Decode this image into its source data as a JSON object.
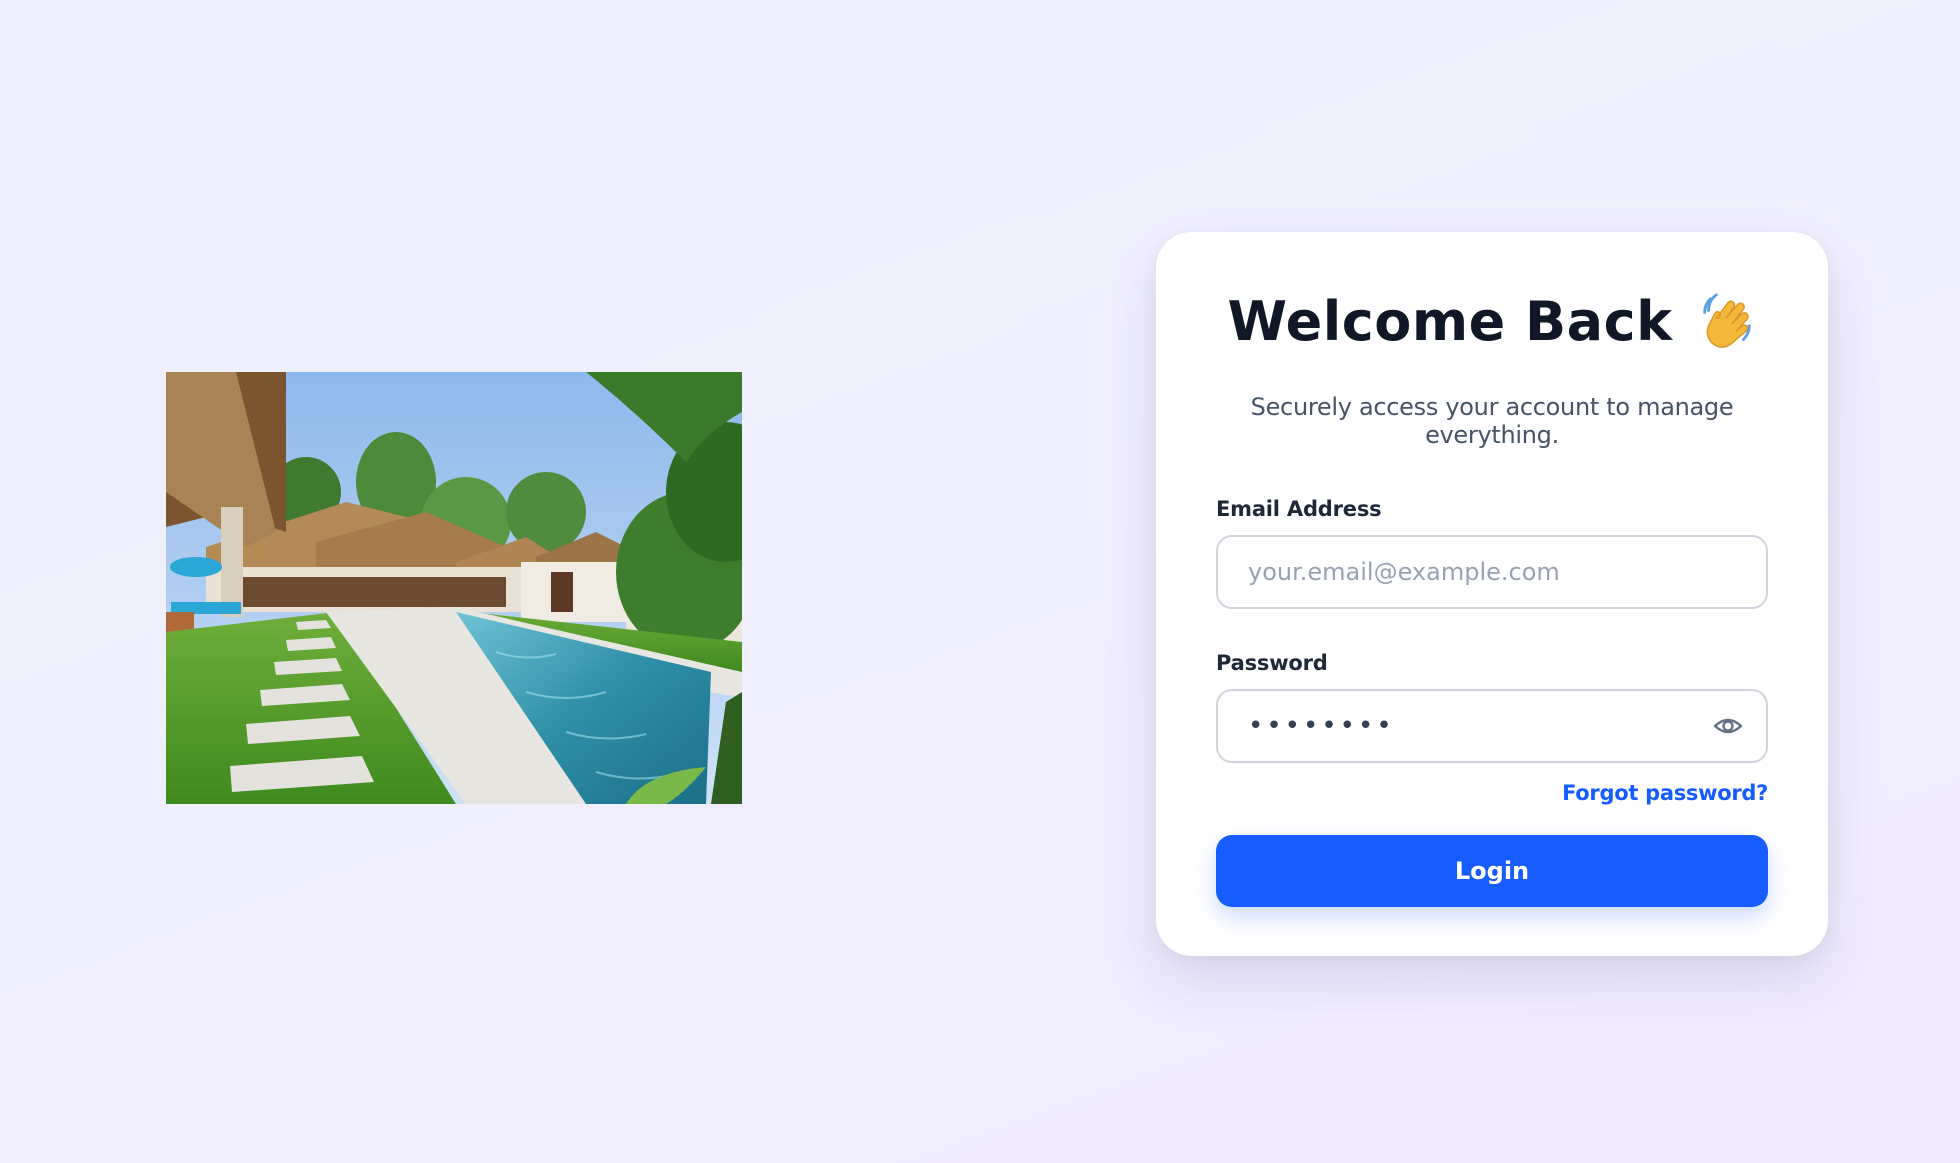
{
  "hero": {
    "image_alt": "villa-pool-garden"
  },
  "card": {
    "title": "Welcome Back",
    "title_icon": "waving-hand-icon",
    "subtitle": "Securely access your account to manage everything."
  },
  "email": {
    "label": "Email Address",
    "placeholder": "your.email@example.com",
    "value": ""
  },
  "password": {
    "label": "Password",
    "value": "••••••••",
    "toggle_icon": "eye-icon"
  },
  "links": {
    "forgot_password": "Forgot password?"
  },
  "actions": {
    "login_label": "Login"
  },
  "colors": {
    "accent": "#175cff",
    "title": "#101828",
    "background": "#eef0fd"
  }
}
